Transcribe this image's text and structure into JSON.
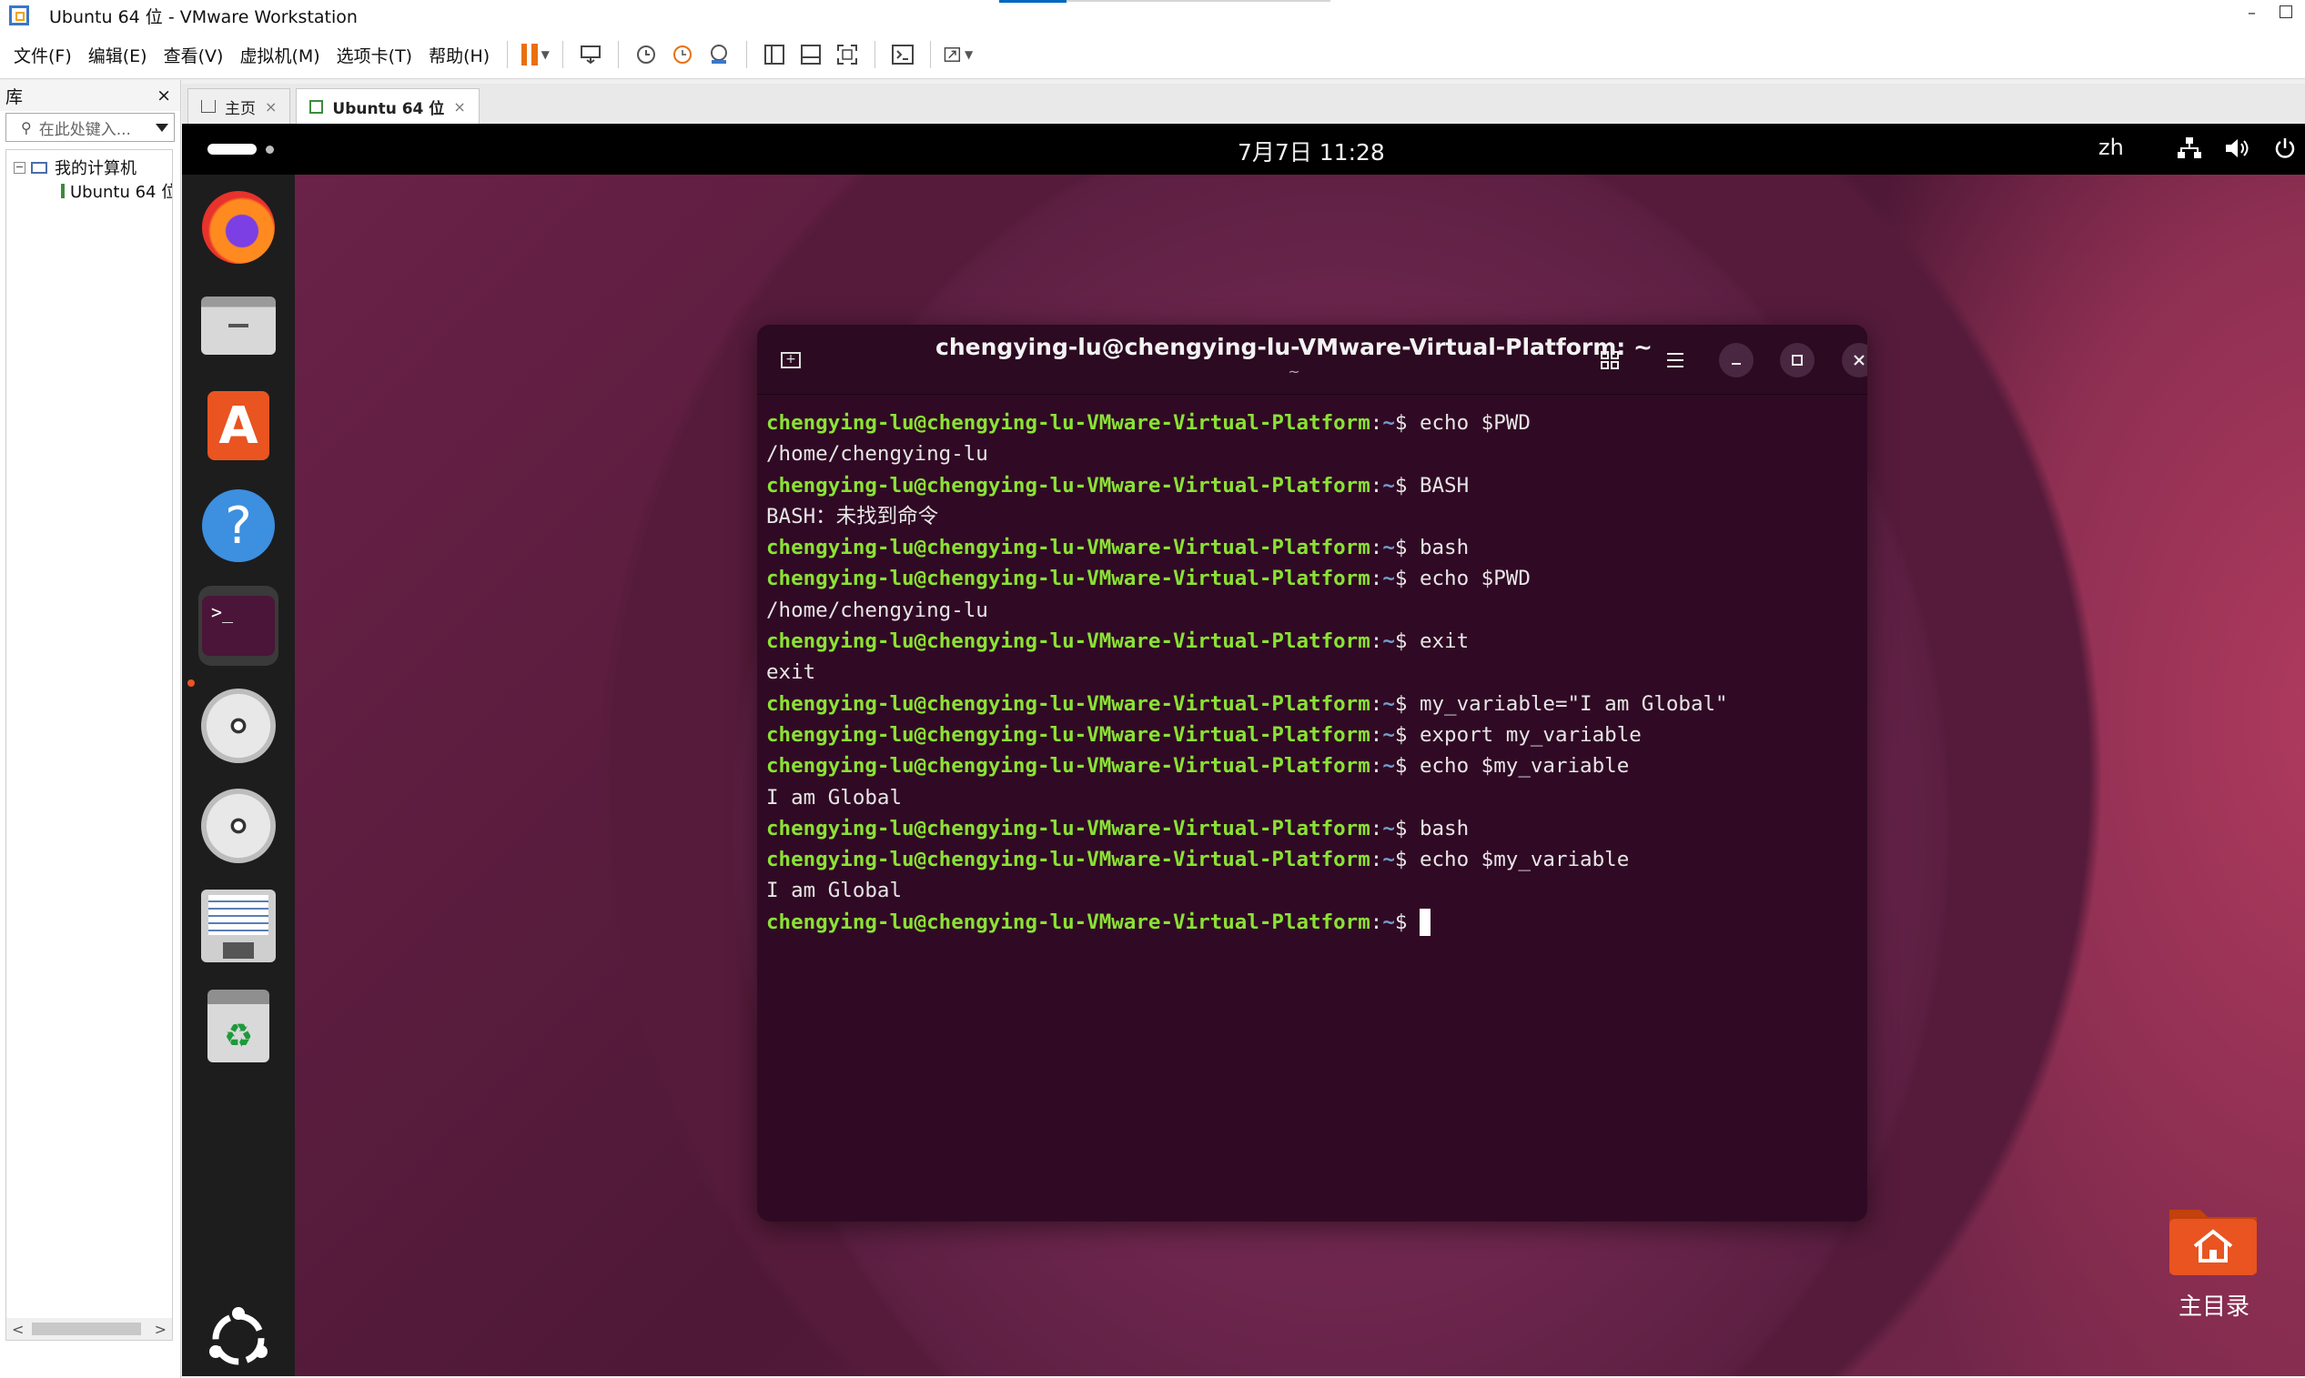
{
  "window": {
    "title": "Ubuntu 64 位 - VMware Workstation",
    "minimize": "–"
  },
  "menu": [
    "文件(F)",
    "编辑(E)",
    "查看(V)",
    "虚拟机(M)",
    "选项卡(T)",
    "帮助(H)"
  ],
  "library": {
    "title": "库",
    "close": "×",
    "search_placeholder": "在此处键入...",
    "tree": {
      "root": "我的计算机",
      "child": "Ubuntu 64 位",
      "expander": "−"
    },
    "scroll_left": "<",
    "scroll_right": ">"
  },
  "tabs": [
    {
      "label": "主页",
      "close": "×"
    },
    {
      "label": "Ubuntu 64 位",
      "close": "×"
    }
  ],
  "ubuntu_topbar": {
    "clock": "7月7日  11:28",
    "lang": "zh",
    "network_icon": "network-wired-icon",
    "volume_icon": "speaker-icon",
    "power_icon": "power-icon"
  },
  "terminal": {
    "title": "chengying-lu@chengying-lu-VMware-Virtual-Platform: ~",
    "subtitle": "~",
    "prompt_user": "chengying-lu@chengying-lu-VMware-Virtual-Platform",
    "prompt_sep": ":",
    "prompt_path": "~",
    "prompt_dollar": "$ ",
    "lines": [
      {
        "type": "cmd",
        "text": "echo $PWD"
      },
      {
        "type": "out",
        "text": "/home/chengying-lu"
      },
      {
        "type": "cmd",
        "text": "BASH"
      },
      {
        "type": "out",
        "text": "BASH：未找到命令"
      },
      {
        "type": "cmd",
        "text": "bash"
      },
      {
        "type": "cmd",
        "text": "echo $PWD"
      },
      {
        "type": "out",
        "text": "/home/chengying-lu"
      },
      {
        "type": "cmd",
        "text": "exit"
      },
      {
        "type": "out",
        "text": "exit"
      },
      {
        "type": "cmd",
        "text": "my_variable=\"I am Global\""
      },
      {
        "type": "cmd",
        "text": "export my_variable"
      },
      {
        "type": "cmd",
        "text": "echo $my_variable"
      },
      {
        "type": "out",
        "text": "I am Global"
      },
      {
        "type": "cmd",
        "text": "bash"
      },
      {
        "type": "cmd",
        "text": "echo $my_variable"
      },
      {
        "type": "out",
        "text": "I am Global"
      },
      {
        "type": "cmd",
        "text": ""
      }
    ]
  },
  "desktop": {
    "home_folder_label": "主目录"
  },
  "colors": {
    "ubuntu_orange": "#e95420",
    "terminal_bg": "#300a24",
    "prompt_green": "#8ae234",
    "prompt_blue": "#729fcf"
  }
}
